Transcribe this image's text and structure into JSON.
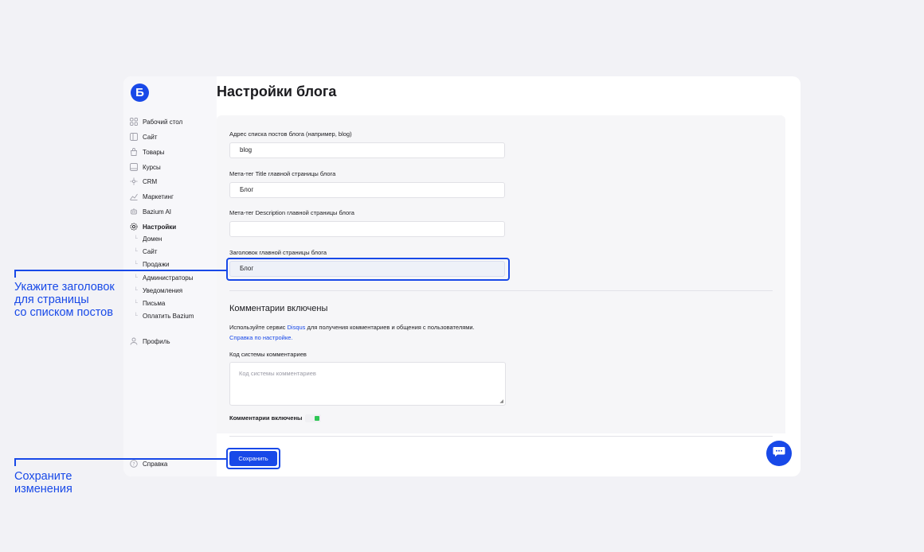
{
  "logo": {
    "letter": "Б"
  },
  "page_title": "Настройки блога",
  "sidebar": {
    "items": [
      {
        "label": "Рабочий стол",
        "icon": "dashboard-icon",
        "glyph": "▫"
      },
      {
        "label": "Сайт",
        "icon": "site-icon",
        "glyph": "▭"
      },
      {
        "label": "Товары",
        "icon": "bag-icon",
        "glyph": "◐"
      },
      {
        "label": "Курсы",
        "icon": "course-icon",
        "glyph": "▢"
      },
      {
        "label": "CRM",
        "icon": "crm-icon",
        "glyph": "✲"
      },
      {
        "label": "Маркетинг",
        "icon": "marketing-icon",
        "glyph": "◭"
      },
      {
        "label": "Bazium AI",
        "icon": "ai-icon",
        "glyph": "◎"
      },
      {
        "label": "Настройки",
        "icon": "gear-icon",
        "glyph": "⚙"
      }
    ],
    "sub_items": [
      {
        "label": "Домен"
      },
      {
        "label": "Сайт"
      },
      {
        "label": "Продажи"
      },
      {
        "label": "Администраторы"
      },
      {
        "label": "Уведомления"
      },
      {
        "label": "Письма"
      },
      {
        "label": "Оплатить Bazium"
      }
    ],
    "profile": {
      "label": "Профиль",
      "icon": "user-icon",
      "glyph": "⚇"
    },
    "help": {
      "label": "Справка",
      "icon": "help-icon",
      "glyph": "?"
    }
  },
  "form": {
    "posts_url": {
      "label": "Адрес списка постов блога (например, blog)",
      "value": "blog"
    },
    "meta_title": {
      "label": "Мета-тег Title главной страницы блога",
      "value": "Блог"
    },
    "meta_description": {
      "label": "Мета-тег Description главной страницы блога",
      "value": ""
    },
    "main_heading": {
      "label": "Заголовок главной страницы блога",
      "value": "Блог"
    }
  },
  "comments": {
    "title": "Комментарии включены",
    "desc_before": "Используйте сервис ",
    "desc_link": "Disqus",
    "desc_after": " для получения комментариев и общения с пользователями.",
    "help_link": "Справка по настройке.",
    "code_label": "Код системы комментариев",
    "code_placeholder": "Код системы комментариев",
    "toggle_label": "Комментарии включены",
    "toggle_on": true
  },
  "save_button": "Сохранить",
  "callouts": {
    "heading_hint": "Укажите заголовок\nдля страницы\nсо списком постов",
    "save_hint": "Сохраните\nизменения"
  },
  "colors": {
    "accent": "#1849e8",
    "toggle_on": "#2fc655"
  }
}
